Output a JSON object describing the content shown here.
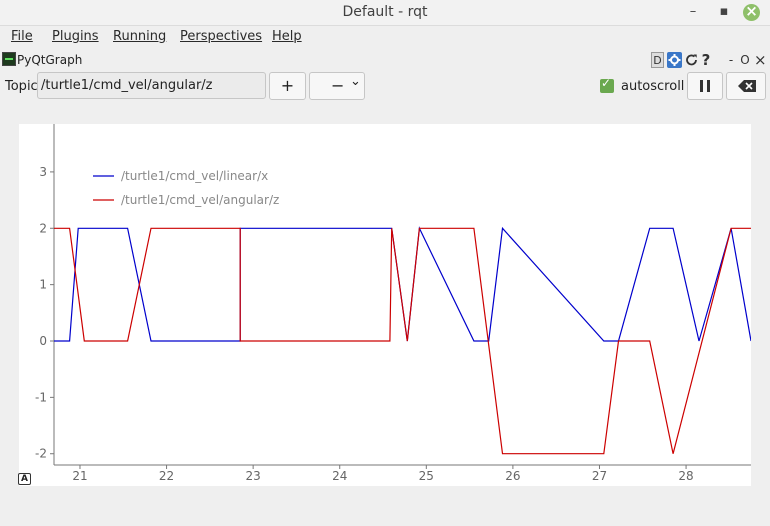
{
  "window": {
    "title": "Default - rqt",
    "minimize_glyph": "–",
    "restore_glyph": "▪"
  },
  "menubar": {
    "items": [
      "File",
      "Plugins",
      "Running",
      "Perspectives",
      "Help"
    ]
  },
  "plugin": {
    "title": "PyQtGraph",
    "icon": "pyqtgraph-icon",
    "buttons": {
      "d": "D",
      "help": "?",
      "minus": "-",
      "circle": "O",
      "close": "×"
    }
  },
  "toolbar": {
    "topic_label": "Topic",
    "topic_value": "/turtle1/cmd_vel/angular/z",
    "add": "+",
    "remove": "−",
    "remove_arrow": "⌄",
    "autoscroll_label": "autoscroll",
    "autoscroll_checked": true
  },
  "reset_button": "A",
  "colors": {
    "linear": "#0000cc",
    "angular": "#cc0000"
  },
  "chart_data": {
    "type": "line",
    "xlim": [
      20.7,
      28.75
    ],
    "ylim": [
      -2.2,
      3.85
    ],
    "xticks": [
      21,
      22,
      23,
      24,
      25,
      26,
      27,
      28
    ],
    "yticks": [
      3,
      2,
      1,
      0,
      -1,
      -2
    ],
    "legend_placement": "top-left",
    "grid": false,
    "series": [
      {
        "name": "/turtle1/cmd_vel/linear/x",
        "color": "#0000cc",
        "x": [
          20.7,
          20.88,
          20.98,
          21.55,
          21.82,
          22.85,
          22.85,
          24.6,
          24.78,
          24.92,
          25.55,
          25.72,
          25.88,
          27.05,
          27.22,
          27.58,
          27.85,
          28.15,
          28.52,
          28.75
        ],
        "y": [
          0,
          0,
          2,
          2,
          0,
          0,
          2,
          2,
          0,
          2,
          0,
          0,
          2,
          0,
          0,
          2,
          2,
          0,
          2,
          0
        ]
      },
      {
        "name": "/turtle1/cmd_vel/angular/z",
        "color": "#cc0000",
        "x": [
          20.7,
          20.88,
          21.05,
          21.55,
          21.82,
          22.85,
          22.85,
          24.58,
          24.6,
          24.78,
          24.92,
          25.55,
          25.88,
          27.05,
          27.22,
          27.58,
          27.85,
          28.52,
          28.75
        ],
        "y": [
          2,
          2,
          0,
          0,
          2,
          2,
          0,
          0,
          2,
          0,
          2,
          2,
          -2,
          -2,
          0,
          0,
          -2,
          2,
          2
        ]
      }
    ]
  }
}
